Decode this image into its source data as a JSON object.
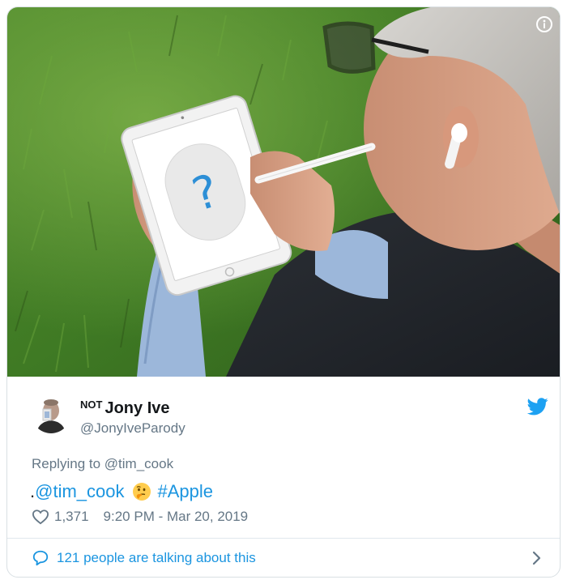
{
  "tweet": {
    "display_name_prefix": "NOT",
    "display_name": "Jony Ive",
    "handle": "@JonyIveParody",
    "replying_to_label": "Replying to",
    "replying_to_user": "@tim_cook",
    "text_prefix": ".",
    "text_mention": "@tim_cook",
    "emoji": "thinking-face-emoji",
    "text_hashtag": "#Apple",
    "likes": "1,371",
    "timestamp": "9:20 PM - Mar 20, 2019",
    "talking_text": "121 people are talking about this"
  },
  "icons": {
    "info": "info-icon",
    "bird": "twitter-bird-icon",
    "heart": "heart-outline-icon",
    "comment": "speech-bubble-icon",
    "chevron": "chevron-right-icon"
  },
  "colors": {
    "link": "#1b95e0",
    "muted": "#657786",
    "text": "#14171a",
    "border": "#e1e8ed"
  }
}
